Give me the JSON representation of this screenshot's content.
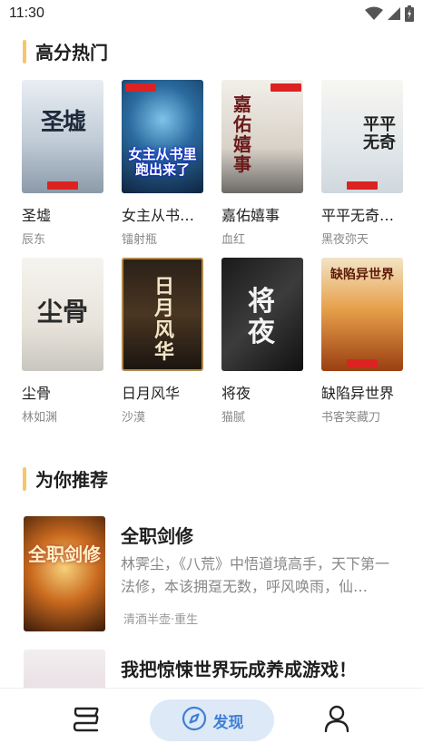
{
  "status": {
    "time": "11:30"
  },
  "sections": {
    "hot": {
      "title": "高分热门"
    },
    "recommend": {
      "title": "为你推荐"
    }
  },
  "hot_books": [
    {
      "title": "圣墟",
      "author": "辰东",
      "cover_text": "圣墟"
    },
    {
      "title": "女主从书里跑出来了",
      "author": "镭射瓶",
      "cover_text": "女主从书里跑出来了"
    },
    {
      "title": "嘉佑嬉事",
      "author": "血红",
      "cover_text": "嘉佑嬉事"
    },
    {
      "title": "平平无奇大师兄",
      "author": "黑夜弥天",
      "cover_text": "平平无奇"
    },
    {
      "title": "尘骨",
      "author": "林如渊",
      "cover_text": "尘骨"
    },
    {
      "title": "日月风华",
      "author": "沙漠",
      "cover_text": "日月风华"
    },
    {
      "title": "将夜",
      "author": "猫腻",
      "cover_text": "将夜"
    },
    {
      "title": "缺陷异世界",
      "author": "书客笑藏刀",
      "cover_text": "缺陷异世界"
    }
  ],
  "recommendations": [
    {
      "title": "全职剑修",
      "cover_text": "全职剑修",
      "description": "林霁尘，《八荒》中悟道境高手，天下第一法修，本该拥趸无数，呼风唤雨，仙…",
      "tags": "清酒半壶·重生"
    },
    {
      "title": "我把惊悚世界玩成养成游戏！",
      "cover_text": ""
    }
  ],
  "bottom_nav": {
    "discover_label": "发现"
  },
  "icons": {
    "wifi": "wifi-icon",
    "signal": "signal-icon",
    "battery": "battery-icon",
    "bookshelf": "bookshelf-icon",
    "compass": "compass-icon",
    "profile": "user-icon"
  },
  "colors": {
    "accent": "#3e7fd6",
    "section_bar": "#f5c76a",
    "nav_active_bg": "#dde9f7"
  }
}
